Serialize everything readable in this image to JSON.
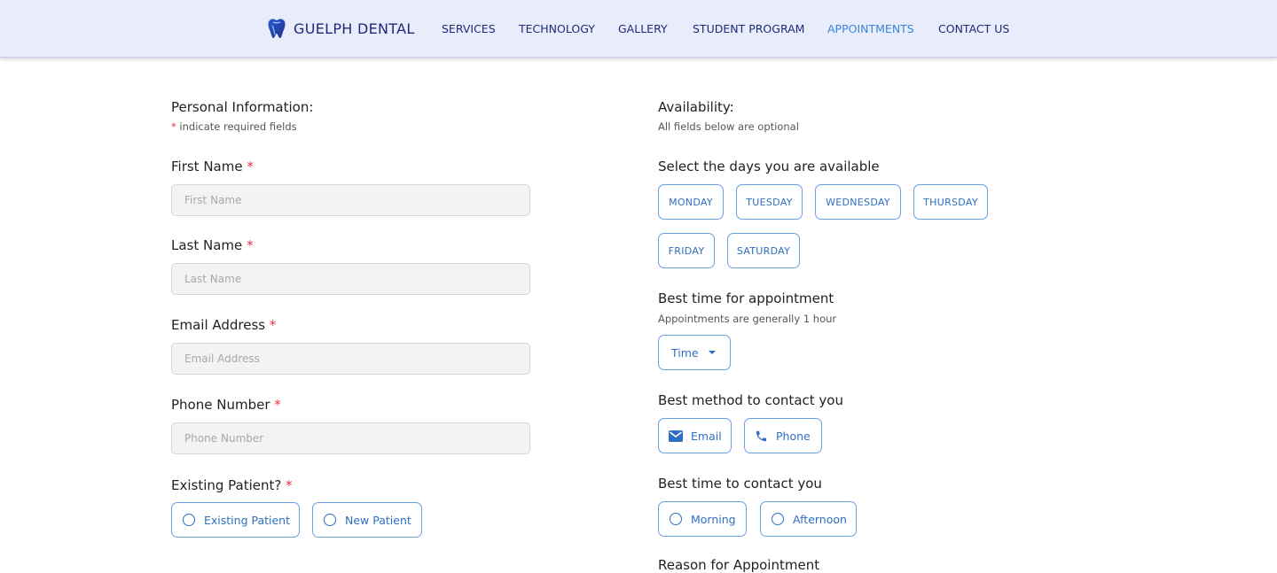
{
  "nav": {
    "brand": "GUELPH DENTAL",
    "links": [
      "SERVICES",
      "TECHNOLOGY",
      "GALLERY",
      "STUDENT PROGRAM",
      "APPOINTMENTS",
      "CONTACT US"
    ],
    "active": "APPOINTMENTS",
    "colors": {
      "bar": "#e8ecfb",
      "text": "#1f2a78",
      "active": "#3a86d8"
    }
  },
  "personal": {
    "heading": "Personal Information:",
    "required_star": "*",
    "required_note": "indicate required fields",
    "first_name": {
      "label": "First Name",
      "placeholder": "First Name"
    },
    "last_name": {
      "label": "Last Name",
      "placeholder": "Last Name"
    },
    "email": {
      "label": "Email Address",
      "placeholder": "Email Address"
    },
    "phone": {
      "label": "Phone Number",
      "placeholder": "Phone Number"
    },
    "existing": {
      "label": "Existing Patient?",
      "options": [
        "Existing Patient",
        "New Patient"
      ]
    }
  },
  "availability": {
    "heading": "Availability:",
    "note": "All fields below are optional",
    "days": {
      "label": "Select the days you are available",
      "options": [
        "MONDAY",
        "TUESDAY",
        "WEDNESDAY",
        "THURSDAY",
        "FRIDAY",
        "SATURDAY"
      ]
    },
    "best_time_appt": {
      "label": "Best time for appointment",
      "note": "Appointments are generally 1 hour",
      "select": "Time"
    },
    "contact_method": {
      "label": "Best method to contact you",
      "options": [
        {
          "label": "Email",
          "icon": "mail-icon"
        },
        {
          "label": "Phone",
          "icon": "phone-icon"
        }
      ]
    },
    "contact_time": {
      "label": "Best time to contact you",
      "options": [
        "Morning",
        "Afternoon"
      ]
    },
    "reason": {
      "label": "Reason for Appointment"
    }
  },
  "colors": {
    "accent": "#2f6fc1",
    "border": "#6a9fe0",
    "required": "#e8334a",
    "input_bg": "#f3f3f3"
  }
}
